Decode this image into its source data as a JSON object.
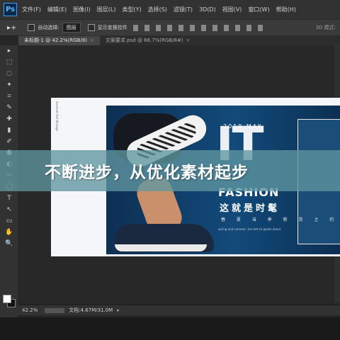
{
  "app": {
    "logo": "Ps",
    "menu": [
      "文件(F)",
      "编辑(E)",
      "图像(I)",
      "图层(L)",
      "类型(Y)",
      "选择(S)",
      "滤镜(T)",
      "3D(D)",
      "视图(V)",
      "窗口(W)",
      "帮助(H)"
    ]
  },
  "options": {
    "tool_arrow": "▸+",
    "auto_select_label": "自动选择:",
    "auto_select_value": "图层",
    "transform_label": "显示变换控件",
    "mode_3d": "3D 模式:"
  },
  "tabs": [
    {
      "label": "未标题-1 @ 42.2%(RGB/8)",
      "close": "×"
    },
    {
      "label": "文案要求.psd @ 66.7%(RGB/8#)",
      "close": "×"
    }
  ],
  "tools": [
    "▸",
    "⬚",
    "◌",
    "✦",
    "⌗",
    "✎",
    "✚",
    "▮",
    "✐",
    "⬢",
    "◐",
    "✂",
    "◯",
    "T",
    "↖",
    "▭",
    "✋",
    "🔍"
  ],
  "banner": {
    "year": "2019.MAY",
    "big": "IT",
    "fashion": "FASHION",
    "cn_title": "这就是时髦",
    "small": "春 夏 当 季 新 货 之 约",
    "tiny": "spring and summer, too late to goods about",
    "side": "Summer Hot Vintage"
  },
  "overlay": {
    "caption": "不断进步，从优化素材起步"
  },
  "status": {
    "zoom": "42.2%",
    "doc": "文档:4.67M/31.0M",
    "arrow": "▸"
  },
  "colors": {
    "accent": "#3aa0ff",
    "overlay": "#5f96a0",
    "banner_blue": "#124a7a"
  }
}
